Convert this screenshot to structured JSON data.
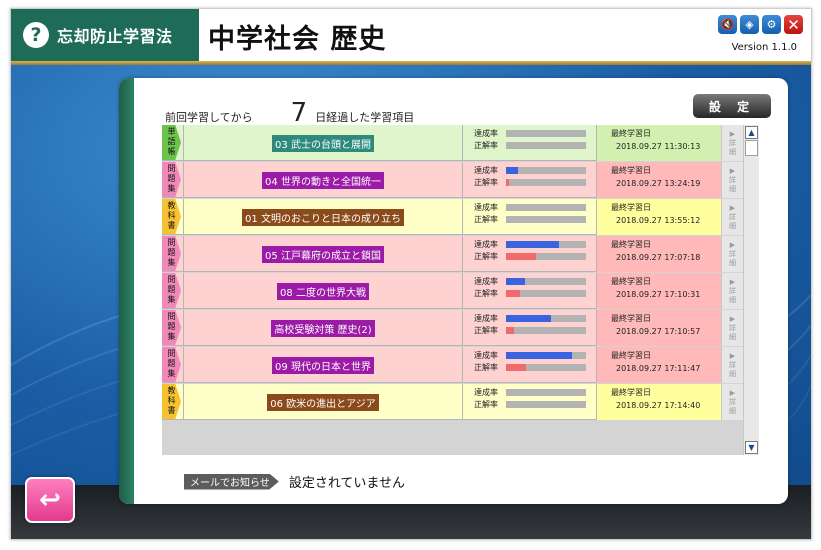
{
  "app": {
    "brand": "忘却防止学習法",
    "title": "中学社会 歴史",
    "version": "Version 1.1.0"
  },
  "window_buttons": [
    {
      "icon": "mute-icon",
      "glyph": "🔇"
    },
    {
      "icon": "cube-icon",
      "glyph": "◈"
    },
    {
      "icon": "gear-icon",
      "glyph": "⚙"
    },
    {
      "icon": "close-icon",
      "glyph": "✕"
    }
  ],
  "header": {
    "prefix": "前回学習してから",
    "days": "7",
    "suffix": "日経過した学習項目"
  },
  "settings_label": "設 定",
  "stat_labels": {
    "achievement": "達成率",
    "correct": "正解率",
    "last": "最終学習日"
  },
  "detail_label": [
    "詳",
    "細"
  ],
  "colors": {
    "achievement_bar": "#3a63e0",
    "correct_bar": "#f06b6b",
    "green_row": "#e0f5cc",
    "green_last": "#d4f0b0",
    "red_row": "#ffd2d2",
    "red_last": "#ffb9b9",
    "yellow_row": "#ffffc8",
    "yellow_last": "#ffff9e",
    "tag_green": "#6dc24a",
    "tag_pink": "#f088ba",
    "tag_yellow": "#f6c232"
  },
  "items": [
    {
      "tag": "単語帳",
      "tag_type": "green",
      "name": "03 武士の台頭と展開",
      "name_bg": "#2d8a7c",
      "row_type": "green",
      "achievement": 0,
      "correct": 0,
      "last_date": "2018.09.27 11:30:13"
    },
    {
      "tag": "問題集",
      "tag_type": "pink",
      "name": "04 世界の動きと全国統一",
      "name_bg": "#9b1aa6",
      "row_type": "red",
      "achievement": 0.15,
      "correct": 0.04,
      "last_date": "2018.09.27 13:24:19"
    },
    {
      "tag": "教科書",
      "tag_type": "yellow",
      "name": "01 文明のおこりと日本の成り立ち",
      "name_bg": "#8b4a1a",
      "row_type": "yellow",
      "achievement": 0,
      "correct": 0,
      "last_date": "2018.09.27 13:55:12"
    },
    {
      "tag": "問題集",
      "tag_type": "pink",
      "name": "05 江戸幕府の成立と鎖国",
      "name_bg": "#9b1aa6",
      "row_type": "red",
      "achievement": 0.66,
      "correct": 0.38,
      "last_date": "2018.09.27 17:07:18"
    },
    {
      "tag": "問題集",
      "tag_type": "pink",
      "name": "08 二度の世界大戦",
      "name_bg": "#9b1aa6",
      "row_type": "red",
      "achievement": 0.24,
      "correct": 0.17,
      "last_date": "2018.09.27 17:10:31"
    },
    {
      "tag": "問題集",
      "tag_type": "pink",
      "name": "高校受験対策 歴史(2)",
      "name_bg": "#9b1aa6",
      "row_type": "red",
      "achievement": 0.56,
      "correct": 0.1,
      "last_date": "2018.09.27 17:10:57"
    },
    {
      "tag": "問題集",
      "tag_type": "pink",
      "name": "09 現代の日本と世界",
      "name_bg": "#9b1aa6",
      "row_type": "red",
      "achievement": 0.82,
      "correct": 0.25,
      "last_date": "2018.09.27 17:11:47"
    },
    {
      "tag": "教科書",
      "tag_type": "yellow",
      "name": "06 欧米の進出とアジア",
      "name_bg": "#8b4a1a",
      "row_type": "yellow",
      "achievement": 0,
      "correct": 0,
      "last_date": "2018.09.27 17:14:40"
    }
  ],
  "mail": {
    "label": "メールでお知らせ",
    "value": "設定されていません"
  },
  "back_icon": "↩"
}
